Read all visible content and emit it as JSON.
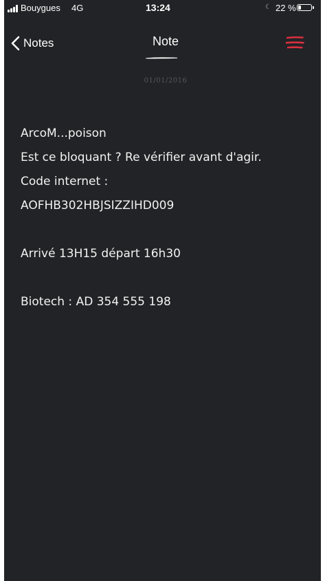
{
  "status_bar": {
    "carrier": "Bouygues",
    "network": "4G",
    "time": "13:24",
    "battery_percent_label": "22 %",
    "battery_level": 0.22
  },
  "nav": {
    "back_label": "Notes",
    "title": "Note"
  },
  "note": {
    "date": "01/01/2016",
    "lines": [
      "ArcoM...poison",
      "Est ce bloquant ? Re vérifier avant d'agir.",
      "Code internet :",
      "AOFHB302HBJSIZZIHD009",
      "",
      "Arrivé 13H15 départ 16h30",
      "",
      "Biotech : AD 354 555 198"
    ]
  },
  "colors": {
    "background": "#222326",
    "text": "#f2f2f2",
    "accent": "#d9303f",
    "date": "#55575c"
  },
  "icons": {
    "back": "chevron-left-icon",
    "menu": "hamburger-menu-icon",
    "moon": "moon-icon",
    "signal": "signal-bars-icon",
    "battery": "battery-icon"
  }
}
